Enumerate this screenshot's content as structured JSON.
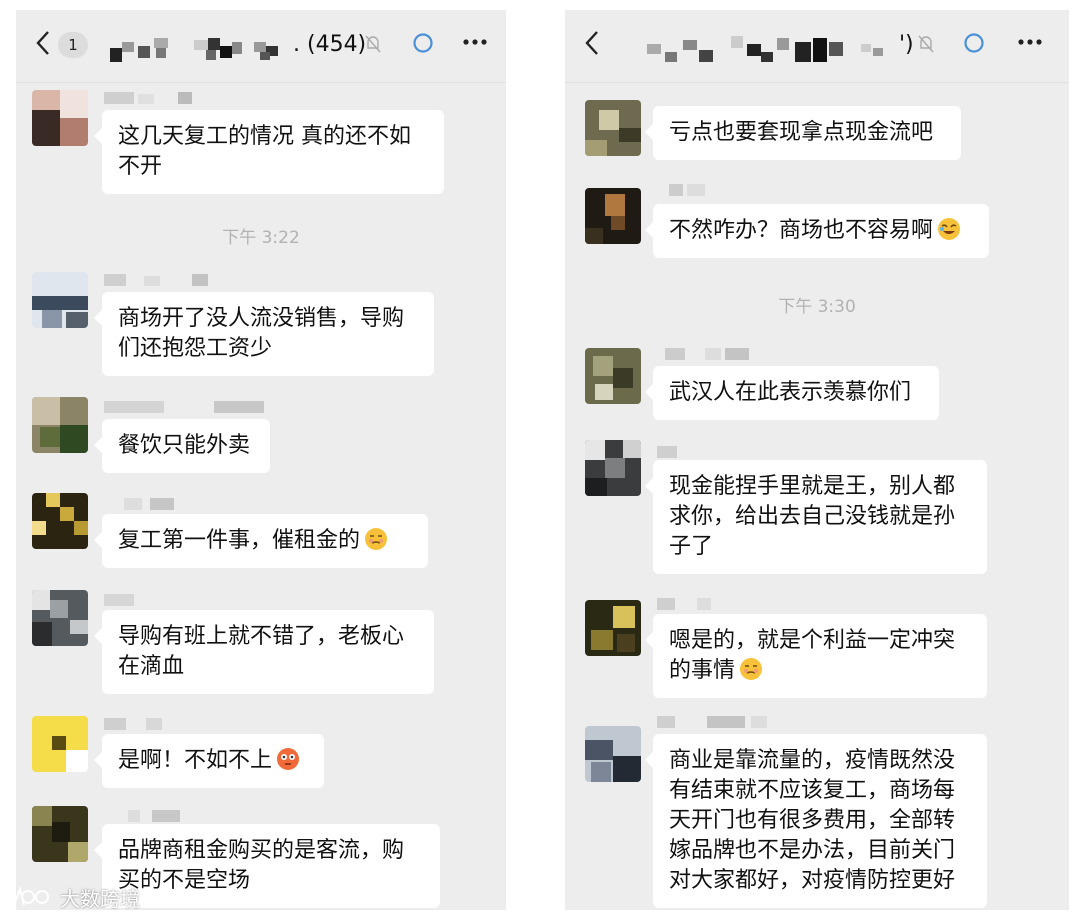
{
  "left_chat": {
    "unread_count": "1",
    "title_suffix": ". (454)",
    "messages": [
      {
        "text": "这几天复工的情况  真的还不如不开"
      },
      {
        "timestamp": "下午 3:22"
      },
      {
        "text": "商场开了没人流没销售，导购们还抱怨工资少"
      },
      {
        "text": "餐饮只能外卖"
      },
      {
        "text": "复工第一件事，催租金的",
        "emoji": "smirk-emoji"
      },
      {
        "text": "导购有班上就不错了，老板心在滴血"
      },
      {
        "text": "是啊！不如不上",
        "emoji": "flushed-emoji"
      },
      {
        "text": "品牌商租金购买的是客流，购买的不是空场"
      }
    ]
  },
  "right_chat": {
    "title_suffix": "')",
    "messages": [
      {
        "text": "亏点也要套现拿点现金流吧"
      },
      {
        "text": "不然咋办？商场也不容易啊",
        "emoji": "rofl-emoji"
      },
      {
        "timestamp": "下午 3:30"
      },
      {
        "text": "武汉人在此表示羡慕你们"
      },
      {
        "text": "现金能捏手里就是王，别人都求你，给出去自己没钱就是孙子了"
      },
      {
        "text": "嗯是的，就是个利益一定冲突的事情",
        "emoji": "smirk-emoji"
      },
      {
        "text": "商业是靠流量的，疫情既然没有结束就不应该复工，商场每天开门也有很多费用，全部转嫁品牌也不是办法，目前关门对大家都好，对疫情防控更好"
      }
    ]
  },
  "watermark": {
    "text": "大数跨境"
  },
  "colors": {
    "background": "#ededed",
    "bubble": "#ffffff",
    "accent_icon": "#4a90d9",
    "timestamp": "#b2b2b2"
  }
}
